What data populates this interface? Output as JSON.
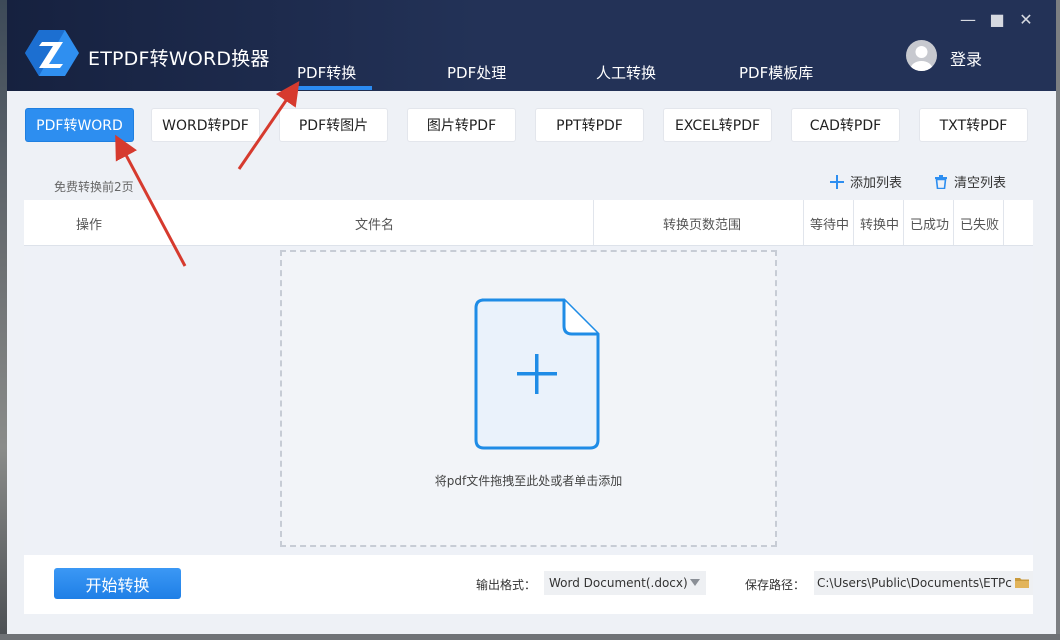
{
  "app": {
    "title": "ETPDF转WORD换器"
  },
  "nav": {
    "tabs": [
      "PDF转换",
      "PDF处理",
      "人工转换",
      "PDF模板库"
    ],
    "active_index": 0
  },
  "user": {
    "login_label": "登录"
  },
  "window_controls": {
    "minimize": "—",
    "maximize": "■",
    "close": "✕"
  },
  "formats": [
    "PDF转WORD",
    "WORD转PDF",
    "PDF转图片",
    "图片转PDF",
    "PPT转PDF",
    "EXCEL转PDF",
    "CAD转PDF",
    "TXT转PDF"
  ],
  "active_format_index": 0,
  "notice": "免费转换前2页",
  "actions": {
    "add": "添加列表",
    "clear": "清空列表"
  },
  "table": {
    "headers": [
      "操作",
      "文件名",
      "转换页数范围",
      "等待中",
      "转换中",
      "已成功",
      "已失败"
    ]
  },
  "dropzone": {
    "hint": "将pdf文件拖拽至此处或者单击添加"
  },
  "bottom": {
    "start_label": "开始转换",
    "format_label": "输出格式：",
    "format_value": "Word Document(.docx)",
    "save_label": "保存路径：",
    "save_path": "C:\\Users\\Public\\Documents\\ETPc"
  },
  "colors": {
    "accent": "#2d8ef0",
    "titlebar": "#233257",
    "annotation_arrow": "#d63a2e"
  }
}
